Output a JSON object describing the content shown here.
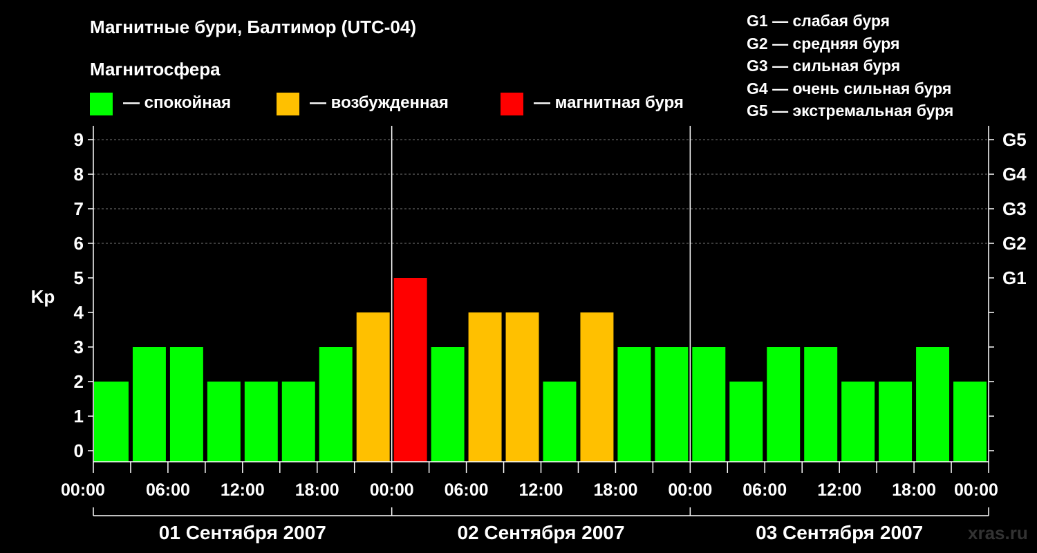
{
  "header": {
    "title": "Магнитные бури, Балтимор (UTC-04)",
    "legend_heading": "Магнитосфера",
    "legend_items": [
      {
        "label": "— спокойная",
        "color": "#00ff00"
      },
      {
        "label": "— возбужденная",
        "color": "#ffc000"
      },
      {
        "label": "— магнитная буря",
        "color": "#ff0000"
      }
    ],
    "storm_scale": [
      "G1 — слабая буря",
      "G2 — средняя буря",
      "G3 — сильная буря",
      "G4 — очень сильная буря",
      "G5 — экстремальная буря"
    ]
  },
  "watermark": "xras.ru",
  "colors": {
    "background": "#000000",
    "quiet": "#00ff00",
    "active": "#ffc000",
    "storm": "#ff0000",
    "axis": "#ffffff",
    "grid": "#777777"
  },
  "chart_data": {
    "type": "bar",
    "ylabel": "Kp",
    "ylim": [
      0,
      9
    ],
    "yticks": [
      0,
      1,
      2,
      3,
      4,
      5,
      6,
      7,
      8,
      9
    ],
    "right_ticks": [
      {
        "value": 5,
        "label": "G1"
      },
      {
        "value": 6,
        "label": "G2"
      },
      {
        "value": 7,
        "label": "G3"
      },
      {
        "value": 8,
        "label": "G4"
      },
      {
        "value": 9,
        "label": "G5"
      }
    ],
    "grid_y": [
      6,
      7,
      8,
      9
    ],
    "x_hours_range": [
      0,
      72
    ],
    "xtick_labels": [
      "00:00",
      "06:00",
      "12:00",
      "18:00",
      "00:00",
      "06:00",
      "12:00",
      "18:00",
      "00:00",
      "06:00",
      "12:00",
      "18:00",
      "00:00"
    ],
    "days": [
      "01 Сентября 2007",
      "02 Сентября 2007",
      "03 Сентября 2007"
    ],
    "bar_interval_hours": 3,
    "values": [
      2,
      3,
      3,
      2,
      2,
      2,
      3,
      4,
      5,
      3,
      4,
      4,
      2,
      4,
      3,
      3,
      3,
      2,
      3,
      3,
      2,
      2,
      3,
      2
    ],
    "categories": [
      "quiet",
      "quiet",
      "quiet",
      "quiet",
      "quiet",
      "quiet",
      "quiet",
      "active",
      "storm",
      "quiet",
      "active",
      "active",
      "quiet",
      "active",
      "quiet",
      "quiet",
      "quiet",
      "quiet",
      "quiet",
      "quiet",
      "quiet",
      "quiet",
      "quiet",
      "quiet"
    ]
  }
}
